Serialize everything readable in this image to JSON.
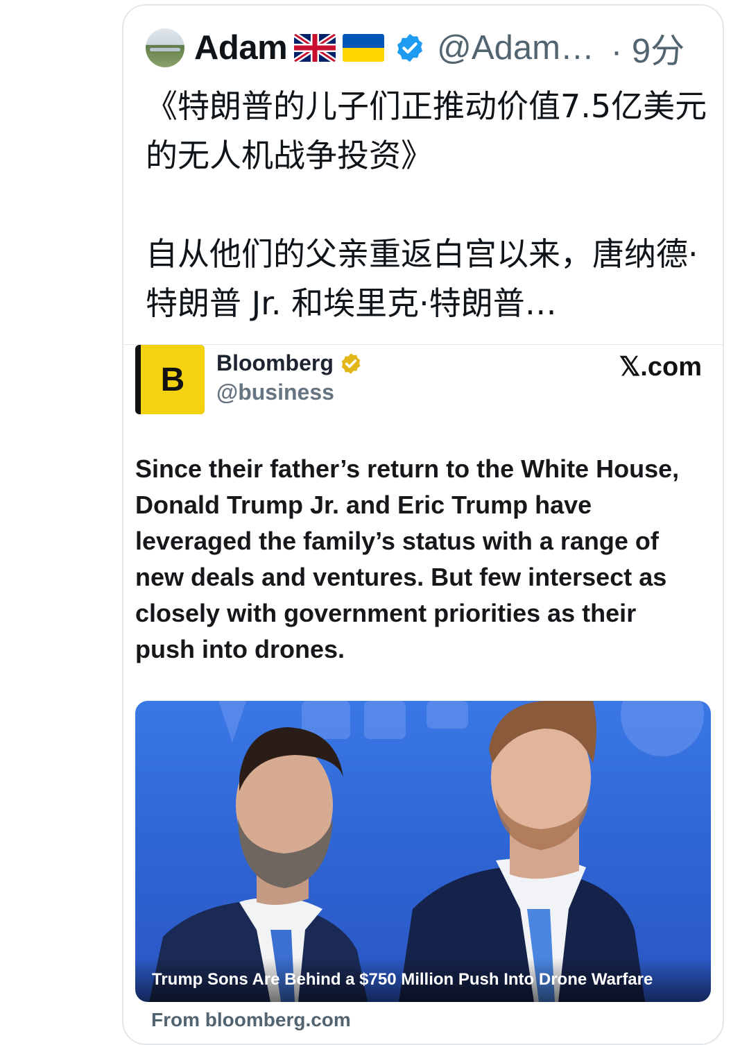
{
  "tweet": {
    "author_name": "Adam",
    "flags": [
      "uk-flag-icon",
      "ukraine-flag-icon"
    ],
    "verified_icon": "verified-badge-icon",
    "handle": "@Adam…",
    "time": "· 9分",
    "text_line1": "《特朗普的儿子们正推动价值7.5亿美元的无人机战争投资》",
    "text_line2": "自从他们的父亲重返白宫以来，唐纳德·特朗普 Jr. 和埃里克·特朗普…"
  },
  "embed": {
    "logo_letter": "B",
    "name": "Bloomberg",
    "verified_icon": "gold-verified-badge-icon",
    "handle": "@business",
    "source": "𝕏.com",
    "body": "Since their father’s return to the White House, Donald Trump Jr. and Eric Trump have leveraged the family’s status with a range of new deals and ventures. But few intersect as closely with government priorities as their push into drones.",
    "photo_caption": "Trump Sons Are Behind a $750 Million Push Into Drone Warfare",
    "link_source": "From bloomberg.com"
  },
  "colors": {
    "accent_verified": "#1d9bf0",
    "bloomberg_yellow": "#f5d20f",
    "muted": "#536471",
    "photo_background": "#2f66d6"
  }
}
